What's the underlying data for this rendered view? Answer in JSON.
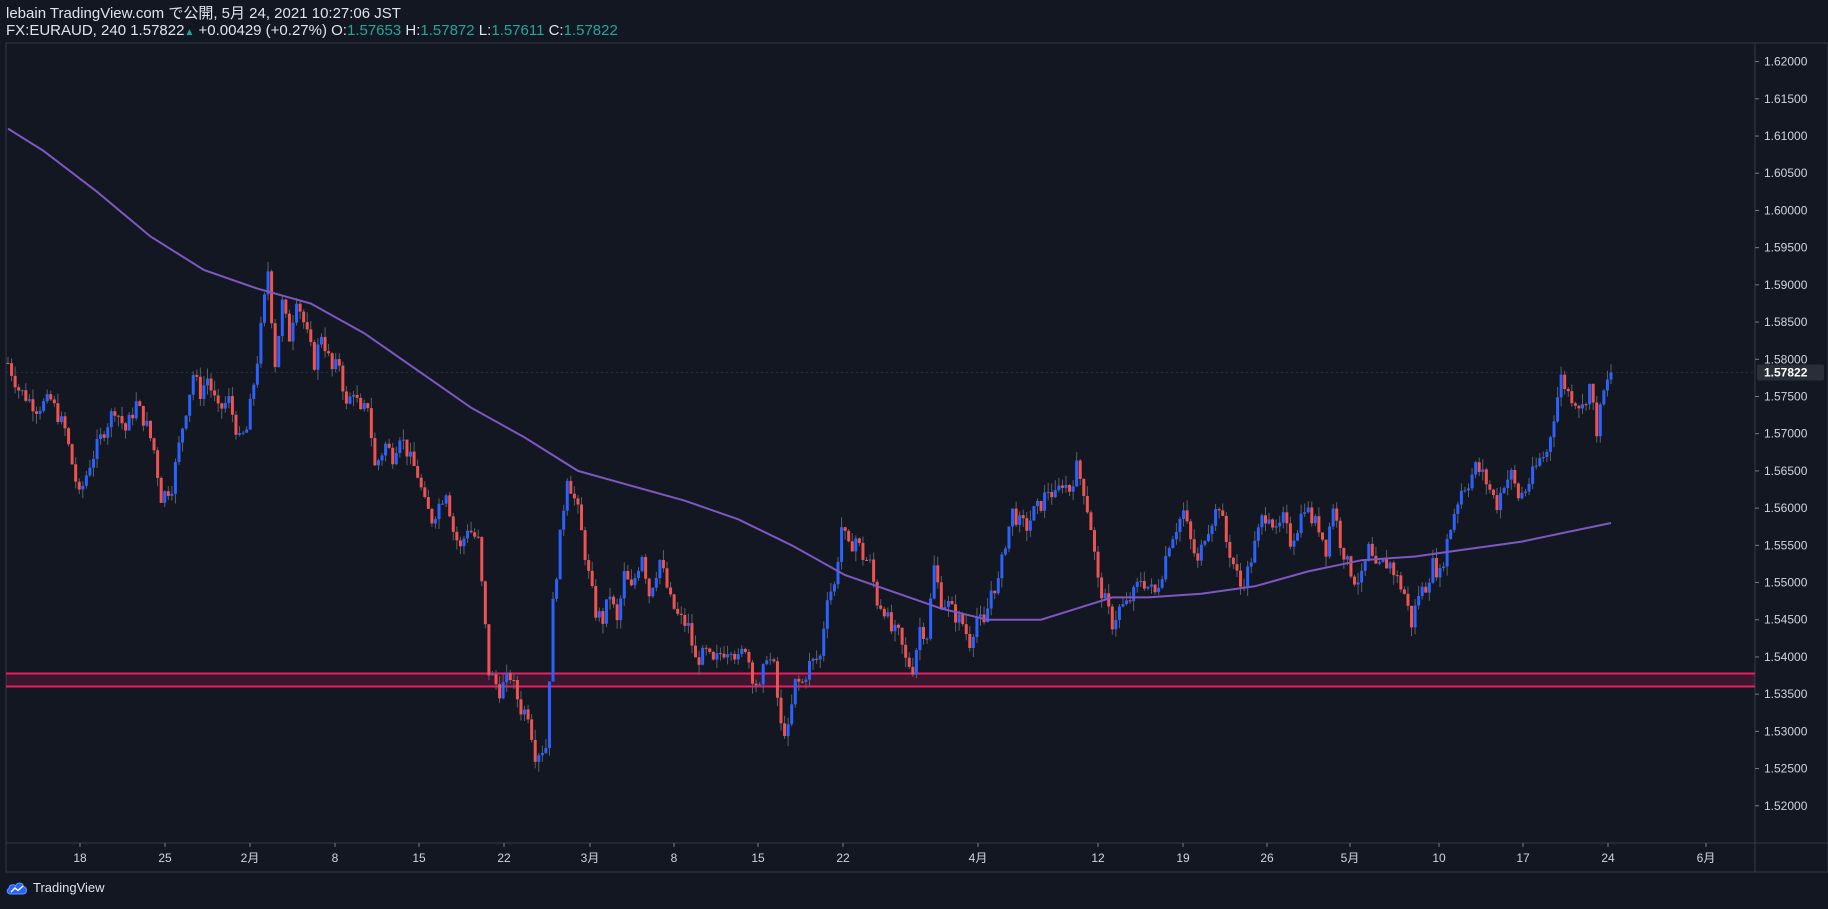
{
  "header": {
    "line1": "lebain TradingView.com で公開, 5月 24, 2021 10:27:06 JST",
    "symbol": "FX:EURAUD, 240",
    "last": "1.57822",
    "change": "+0.00429 (+0.27%)",
    "o_label": "O:",
    "o": "1.57653",
    "h_label": "H:",
    "h": "1.57872",
    "l_label": "L:",
    "l": "1.57611",
    "c_label": "C:",
    "c": "1.57822"
  },
  "footer": {
    "brand": "TradingView"
  },
  "colors": {
    "background": "#131722",
    "up": "#2962ff",
    "up_light": "#3d8bfd",
    "down": "#ef5350",
    "ma": "#7e57c2",
    "zone": "#e91e63",
    "axis_text": "#d1d4dc",
    "ohlc_value": "#26a69a"
  },
  "chart_data": {
    "type": "candlestick",
    "symbol": "FX:EURAUD",
    "timeframe": "240",
    "ylim": [
      1.515,
      1.6225
    ],
    "y_ticks": [
      "1.62000",
      "1.61500",
      "1.61000",
      "1.60500",
      "1.60000",
      "1.59500",
      "1.59000",
      "1.58500",
      "1.58000",
      "1.57500",
      "1.57000",
      "1.56500",
      "1.56000",
      "1.55500",
      "1.55000",
      "1.54500",
      "1.54000",
      "1.53500",
      "1.53000",
      "1.52500",
      "1.52000"
    ],
    "x_ticks": [
      "18",
      "25",
      "2月",
      "8",
      "15",
      "22",
      "3月",
      "8",
      "15",
      "22",
      "4月",
      "12",
      "19",
      "26",
      "5月",
      "10",
      "17",
      "24",
      "6月"
    ],
    "current_price": "1.57822",
    "price_path": [
      [
        0,
        1.5795
      ],
      [
        3,
        1.576
      ],
      [
        8,
        1.5735
      ],
      [
        12,
        1.5745
      ],
      [
        16,
        1.5705
      ],
      [
        20,
        1.5615
      ],
      [
        23,
        1.566
      ],
      [
        27,
        1.5705
      ],
      [
        30,
        1.5735
      ],
      [
        33,
        1.5705
      ],
      [
        36,
        1.574
      ],
      [
        39,
        1.571
      ],
      [
        41,
        1.5678
      ],
      [
        43,
        1.5615
      ],
      [
        46,
        1.563
      ],
      [
        49,
        1.571
      ],
      [
        52,
        1.578
      ],
      [
        54,
        1.5755
      ],
      [
        56,
        1.5775
      ],
      [
        59,
        1.573
      ],
      [
        62,
        1.5745
      ],
      [
        65,
        1.569
      ],
      [
        67,
        1.5705
      ],
      [
        70,
        1.58
      ],
      [
        73,
        1.592
      ],
      [
        75,
        1.5795
      ],
      [
        77,
        1.5875
      ],
      [
        79,
        1.583
      ],
      [
        81,
        1.5885
      ],
      [
        83,
        1.585
      ],
      [
        86,
        1.5795
      ],
      [
        88,
        1.5835
      ],
      [
        91,
        1.5785
      ],
      [
        93,
        1.5795
      ],
      [
        95,
        1.5735
      ],
      [
        97,
        1.576
      ],
      [
        99,
        1.5725
      ],
      [
        101,
        1.574
      ],
      [
        103,
        1.5655
      ],
      [
        106,
        1.5685
      ],
      [
        108,
        1.567
      ],
      [
        110,
        1.57
      ],
      [
        113,
        1.5665
      ],
      [
        115,
        1.5645
      ],
      [
        117,
        1.5605
      ],
      [
        119,
        1.5585
      ],
      [
        121,
        1.5605
      ],
      [
        123,
        1.5625
      ],
      [
        125,
        1.557
      ],
      [
        127,
        1.5545
      ],
      [
        129,
        1.5575
      ],
      [
        132,
        1.5555
      ],
      [
        135,
        1.538
      ],
      [
        138,
        1.5355
      ],
      [
        141,
        1.5375
      ],
      [
        144,
        1.533
      ],
      [
        146,
        1.5325
      ],
      [
        148,
        1.527
      ],
      [
        151,
        1.528
      ],
      [
        153,
        1.547
      ],
      [
        155,
        1.556
      ],
      [
        157,
        1.5645
      ],
      [
        160,
        1.5595
      ],
      [
        163,
        1.551
      ],
      [
        165,
        1.546
      ],
      [
        167,
        1.545
      ],
      [
        169,
        1.5485
      ],
      [
        171,
        1.5445
      ],
      [
        173,
        1.551
      ],
      [
        175,
        1.549
      ],
      [
        178,
        1.554
      ],
      [
        180,
        1.5485
      ],
      [
        183,
        1.553
      ],
      [
        186,
        1.5475
      ],
      [
        188,
        1.5455
      ],
      [
        191,
        1.544
      ],
      [
        193,
        1.5395
      ],
      [
        196,
        1.5405
      ],
      [
        198,
        1.539
      ],
      [
        200,
        1.5405
      ],
      [
        203,
        1.5415
      ],
      [
        205,
        1.5395
      ],
      [
        207,
        1.5415
      ],
      [
        209,
        1.5375
      ],
      [
        211,
        1.5355
      ],
      [
        213,
        1.5405
      ],
      [
        215,
        1.5385
      ],
      [
        217,
        1.5305
      ],
      [
        219,
        1.53
      ],
      [
        221,
        1.5365
      ],
      [
        223,
        1.5365
      ],
      [
        225,
        1.539
      ],
      [
        228,
        1.54
      ],
      [
        230,
        1.5485
      ],
      [
        232,
        1.5495
      ],
      [
        234,
        1.5575
      ],
      [
        236,
        1.5545
      ],
      [
        238,
        1.556
      ],
      [
        240,
        1.5535
      ],
      [
        242,
        1.5525
      ],
      [
        244,
        1.5475
      ],
      [
        246,
        1.5465
      ],
      [
        248,
        1.5435
      ],
      [
        250,
        1.543
      ],
      [
        252,
        1.5395
      ],
      [
        254,
        1.5385
      ],
      [
        256,
        1.544
      ],
      [
        258,
        1.543
      ],
      [
        260,
        1.552
      ],
      [
        262,
        1.5475
      ],
      [
        264,
        1.547
      ],
      [
        266,
        1.5455
      ],
      [
        268,
        1.5445
      ],
      [
        270,
        1.542
      ],
      [
        272,
        1.5455
      ],
      [
        274,
        1.544
      ],
      [
        276,
        1.549
      ],
      [
        278,
        1.55
      ],
      [
        280,
        1.5555
      ],
      [
        282,
        1.5595
      ],
      [
        284,
        1.558
      ],
      [
        286,
        1.5575
      ],
      [
        288,
        1.5595
      ],
      [
        290,
        1.5605
      ],
      [
        292,
        1.5625
      ],
      [
        294,
        1.5615
      ],
      [
        296,
        1.5635
      ],
      [
        298,
        1.5625
      ],
      [
        300,
        1.5655
      ],
      [
        302,
        1.5625
      ],
      [
        304,
        1.5575
      ],
      [
        306,
        1.55
      ],
      [
        308,
        1.5475
      ],
      [
        310,
        1.5445
      ],
      [
        312,
        1.5465
      ],
      [
        314,
        1.547
      ],
      [
        316,
        1.5485
      ],
      [
        318,
        1.5505
      ],
      [
        320,
        1.5495
      ],
      [
        322,
        1.5485
      ],
      [
        324,
        1.5515
      ],
      [
        326,
        1.5555
      ],
      [
        328,
        1.5575
      ],
      [
        330,
        1.5595
      ],
      [
        332,
        1.5555
      ],
      [
        334,
        1.5525
      ],
      [
        336,
        1.5565
      ],
      [
        338,
        1.5585
      ],
      [
        340,
        1.5605
      ],
      [
        342,
        1.5555
      ],
      [
        344,
        1.5525
      ],
      [
        346,
        1.5495
      ],
      [
        348,
        1.5515
      ],
      [
        350,
        1.555
      ],
      [
        352,
        1.5585
      ],
      [
        354,
        1.5595
      ],
      [
        356,
        1.5565
      ],
      [
        358,
        1.5585
      ],
      [
        360,
        1.5555
      ],
      [
        362,
        1.5575
      ],
      [
        364,
        1.5605
      ],
      [
        366,
        1.5585
      ],
      [
        368,
        1.5575
      ],
      [
        370,
        1.5545
      ],
      [
        372,
        1.5605
      ],
      [
        374,
        1.5555
      ],
      [
        376,
        1.5525
      ],
      [
        378,
        1.5505
      ],
      [
        380,
        1.5505
      ],
      [
        382,
        1.5545
      ],
      [
        384,
        1.5515
      ],
      [
        386,
        1.5525
      ],
      [
        388,
        1.5525
      ],
      [
        390,
        1.5505
      ],
      [
        392,
        1.5485
      ],
      [
        394,
        1.5445
      ],
      [
        396,
        1.5485
      ],
      [
        398,
        1.5495
      ],
      [
        400,
        1.5525
      ],
      [
        402,
        1.551
      ],
      [
        404,
        1.5555
      ],
      [
        406,
        1.5595
      ],
      [
        408,
        1.5625
      ],
      [
        410,
        1.5635
      ],
      [
        412,
        1.5655
      ],
      [
        414,
        1.5645
      ],
      [
        416,
        1.5625
      ],
      [
        418,
        1.5605
      ],
      [
        420,
        1.5635
      ],
      [
        422,
        1.5645
      ],
      [
        424,
        1.5615
      ],
      [
        426,
        1.5625
      ],
      [
        428,
        1.5645
      ],
      [
        430,
        1.5665
      ],
      [
        432,
        1.5675
      ],
      [
        434,
        1.5725
      ],
      [
        436,
        1.5775
      ],
      [
        438,
        1.5755
      ],
      [
        440,
        1.5745
      ],
      [
        442,
        1.5735
      ],
      [
        444,
        1.5765
      ],
      [
        446,
        1.5705
      ],
      [
        448,
        1.5755
      ],
      [
        450,
        1.5782
      ]
    ],
    "sma_path": [
      [
        0,
        1.611
      ],
      [
        10,
        1.608
      ],
      [
        25,
        1.6025
      ],
      [
        40,
        1.5965
      ],
      [
        55,
        1.592
      ],
      [
        70,
        1.5895
      ],
      [
        85,
        1.5875
      ],
      [
        100,
        1.5835
      ],
      [
        115,
        1.5785
      ],
      [
        130,
        1.5735
      ],
      [
        145,
        1.5695
      ],
      [
        160,
        1.565
      ],
      [
        175,
        1.563
      ],
      [
        190,
        1.561
      ],
      [
        205,
        1.5585
      ],
      [
        220,
        1.555
      ],
      [
        235,
        1.551
      ],
      [
        250,
        1.5485
      ],
      [
        262,
        1.5465
      ],
      [
        275,
        1.545
      ],
      [
        290,
        1.545
      ],
      [
        300,
        1.5465
      ],
      [
        310,
        1.548
      ],
      [
        320,
        1.548
      ],
      [
        335,
        1.5485
      ],
      [
        350,
        1.5495
      ],
      [
        365,
        1.5515
      ],
      [
        380,
        1.553
      ],
      [
        395,
        1.5535
      ],
      [
        410,
        1.5545
      ],
      [
        425,
        1.5555
      ],
      [
        440,
        1.557
      ],
      [
        450,
        1.558
      ]
    ],
    "support_zone": [
      1.5363,
      1.5375
    ],
    "current_price_line": 1.57822
  }
}
